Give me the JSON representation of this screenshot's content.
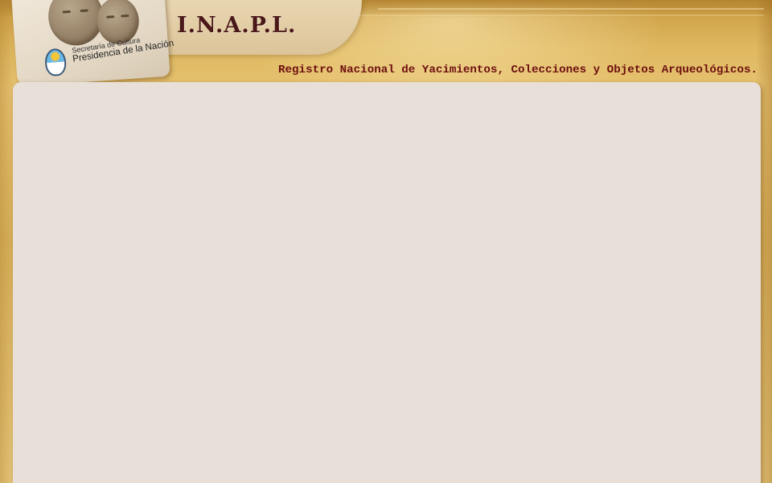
{
  "header": {
    "title": "I.N.A.P.L.",
    "subtitle": "Registro Nacional de Yacimientos, Colecciones y Objetos Arqueológicos."
  },
  "logo": {
    "org_line1": "Secretaría de Cultura",
    "org_line2": "Presidencia de la Nación",
    "emblem_icon": "argentina-coat-of-arms-icon",
    "artwork_icon": "archaeological-faces-icon"
  },
  "colors": {
    "background_gold": "#dfb860",
    "title_color": "#4a1818",
    "subtitle_color": "#6d0f0f",
    "panel_bg": "#e8e0d8"
  },
  "main": {
    "content": ""
  }
}
